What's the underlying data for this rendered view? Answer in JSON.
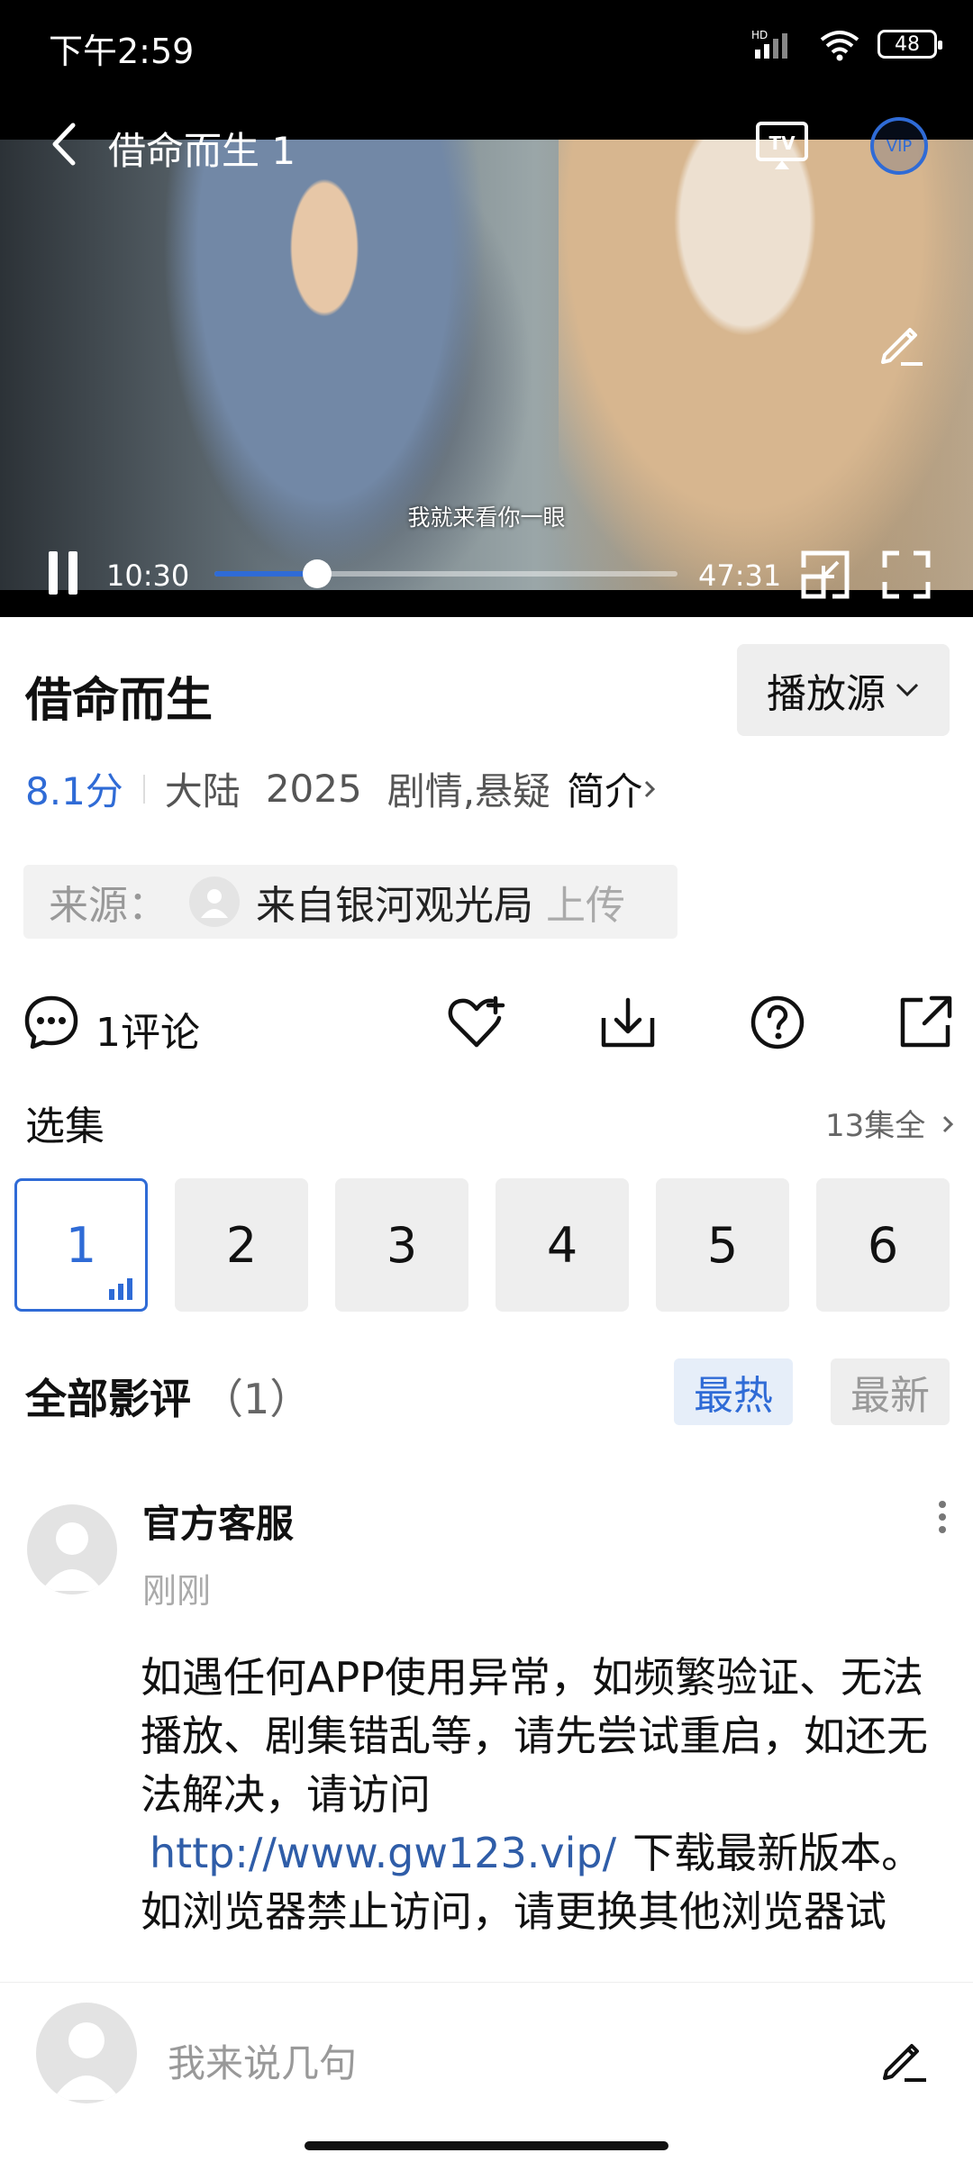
{
  "status_bar": {
    "time": "下午2:59",
    "battery": "48",
    "network": "HD"
  },
  "player": {
    "title": "借命而生 1",
    "subtitle": "我就来看你一眼",
    "current_time": "10:30",
    "duration": "47:31",
    "progress": 0.221,
    "vip_badge": "VIP",
    "accent_color": "#2f6bd6"
  },
  "show": {
    "title": "借命而生",
    "source_button": "播放源",
    "score": "8.1分",
    "region": "大陆",
    "year": "2025",
    "genres": "剧情,悬疑",
    "intro_label": "简介"
  },
  "uploader": {
    "label": "来源：",
    "name": "来自银河观光局",
    "suffix": "上传"
  },
  "actions": {
    "comment_count": "1评论"
  },
  "episodes": {
    "section_title": "选集",
    "all_label": "13集全",
    "items": [
      "1",
      "2",
      "3",
      "4",
      "5",
      "6"
    ],
    "active_index": 0
  },
  "reviews": {
    "title": "全部影评",
    "count": "（1）",
    "sort_hot": "最热",
    "sort_new": "最新",
    "items": [
      {
        "author": "官方客服",
        "time": "刚刚",
        "text_1": "如遇任何APP使用异常，如频繁验证、无法播放、剧集错乱等，请先尝试重启，如还无法解决，请访问",
        "link": "http://www.gw123.vip/",
        "text_2": "下载最新版本。",
        "text_3": "如浏览器禁止访问，请更换其他浏览器试"
      }
    ]
  },
  "composer": {
    "placeholder": "我来说几句"
  }
}
